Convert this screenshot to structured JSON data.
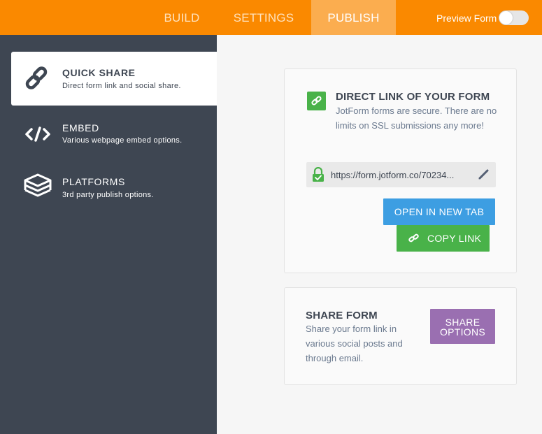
{
  "topbar": {
    "tabs": [
      {
        "label": "BUILD"
      },
      {
        "label": "SETTINGS"
      },
      {
        "label": "PUBLISH"
      }
    ],
    "active_tab": "PUBLISH",
    "preview_label": "Preview Form",
    "preview_enabled": false
  },
  "sidebar": {
    "items": [
      {
        "title": "QUICK SHARE",
        "description": "Direct form link and social share.",
        "icon": "link-icon",
        "active": true
      },
      {
        "title": "EMBED",
        "description": "Various webpage embed options.",
        "icon": "code-icon",
        "active": false
      },
      {
        "title": "PLATFORMS",
        "description": "3rd party publish options.",
        "icon": "layers-icon",
        "active": false
      }
    ]
  },
  "direct_link": {
    "heading": "DIRECT LINK OF YOUR FORM",
    "description": "JotForm forms are secure. There are no limits on SSL submissions any more!",
    "url": "https://form.jotform.co/70234...",
    "open_button": "OPEN IN NEW TAB",
    "copy_button": "COPY LINK"
  },
  "share_form": {
    "heading": "SHARE FORM",
    "description": "Share your form link in various social posts and through email.",
    "button": "SHARE OPTIONS"
  },
  "colors": {
    "topbar": "#fa8900",
    "sidebar": "#3e4652",
    "green": "#49b249",
    "blue": "#3d9ee2",
    "purple": "#9a6fb1"
  }
}
